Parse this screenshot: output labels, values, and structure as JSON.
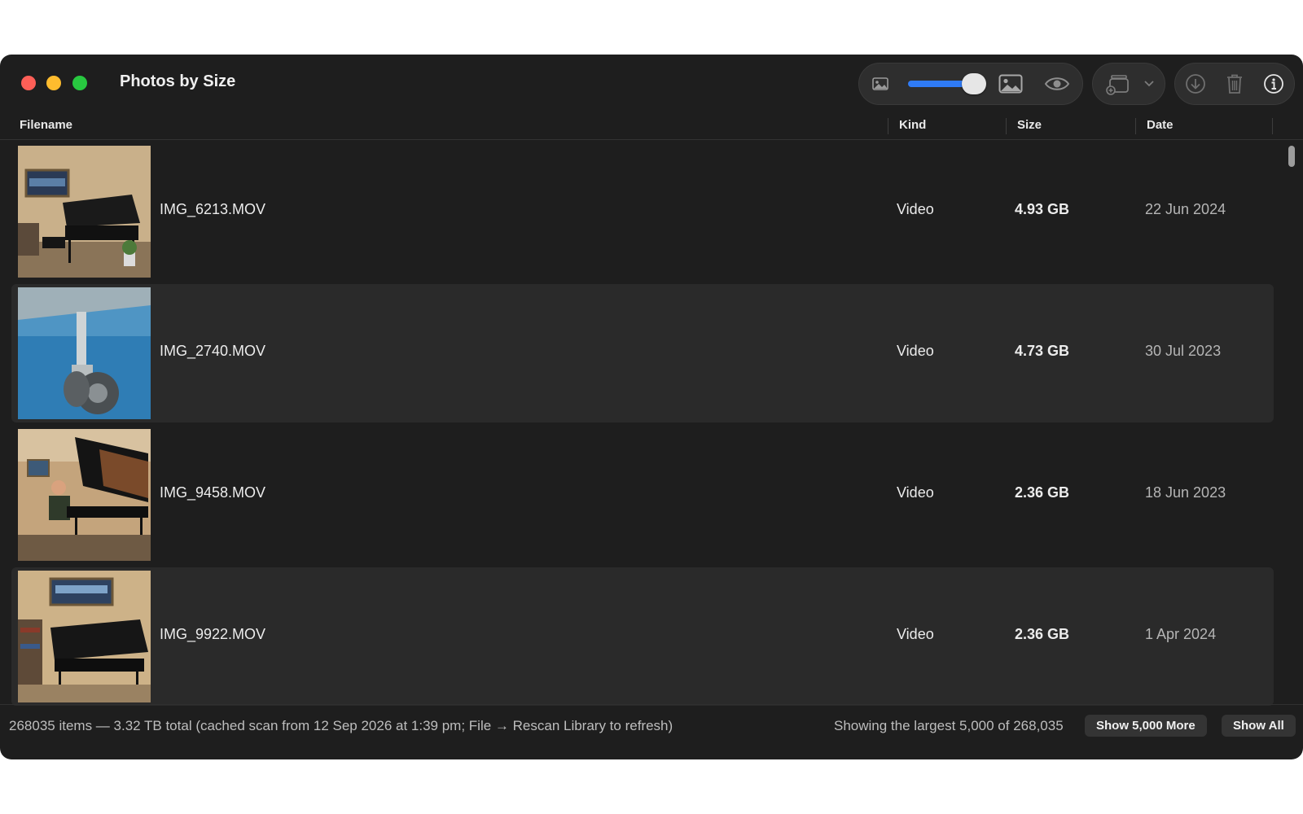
{
  "window": {
    "title": "Photos by Size"
  },
  "toolbar": {
    "icons": [
      "small-photo-icon",
      "thumbnail-size-slider",
      "large-photo-icon",
      "eye-icon",
      "add-to-album-icon",
      "chevron-down-icon",
      "download-icon",
      "trash-icon",
      "info-icon"
    ],
    "thumbnail_size_level": 0.9
  },
  "columns": {
    "filename": "Filename",
    "kind": "Kind",
    "size": "Size",
    "date": "Date"
  },
  "rows": [
    {
      "filename": "IMG_6213.MOV",
      "kind": "Video",
      "size": "4.93 GB",
      "date": "22 Jun 2024",
      "thumb": "piano-room"
    },
    {
      "filename": "IMG_2740.MOV",
      "kind": "Video",
      "size": "4.73 GB",
      "date": "30 Jul 2023",
      "thumb": "aircraft-landing-gear"
    },
    {
      "filename": "IMG_9458.MOV",
      "kind": "Video",
      "size": "2.36 GB",
      "date": "18 Jun 2023",
      "thumb": "pianist-grand-piano"
    },
    {
      "filename": "IMG_9922.MOV",
      "kind": "Video",
      "size": "2.36 GB",
      "date": "1 Apr 2024",
      "thumb": "piano-room"
    }
  ],
  "footer": {
    "status": "268035 items — 3.32 TB total (cached scan from 12 Sep 2026 at 1:39 pm; File → Rescan Library to refresh)",
    "showing": "Showing the largest 5,000 of 268,035",
    "show_more_label": "Show 5,000 More",
    "show_all_label": "Show All"
  },
  "colors": {
    "window_bg": "#1e1e1e",
    "row_alt_bg": "#2a2a2a",
    "accent": "#2f7bf6"
  }
}
